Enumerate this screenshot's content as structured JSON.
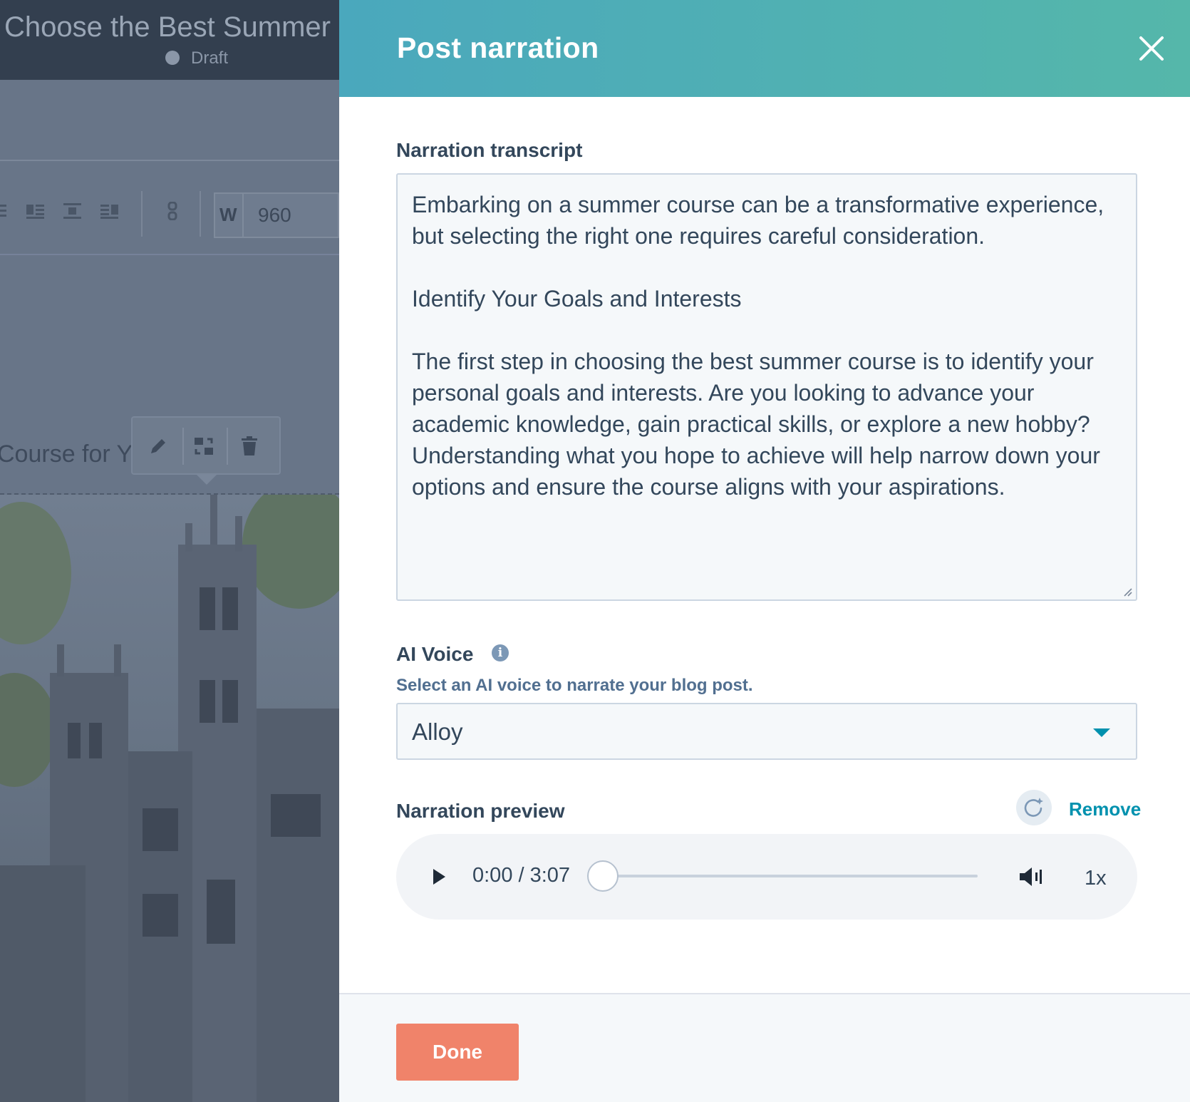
{
  "editor": {
    "doc_title": "Choose the Best Summer Course for You",
    "status": "Draft",
    "width_label": "W",
    "width_value": "960",
    "heading_fragment": "Course for You"
  },
  "panel": {
    "title": "Post narration",
    "transcript_label": "Narration transcript",
    "transcript": "Embarking on a summer course can be a transformative experience, but selecting the right one requires careful consideration.\n\nIdentify Your Goals and Interests\n\nThe first step in choosing the best summer course is to identify your personal goals and interests. Are you looking to advance your academic knowledge, gain practical skills, or explore a new hobby? Understanding what you hope to achieve will help narrow down your options and ensure the course aligns with your aspirations.",
    "voice_label": "AI Voice",
    "voice_help": "Select an AI voice to narrate your blog post.",
    "voice_selected": "Alloy",
    "preview_label": "Narration preview",
    "remove_label": "Remove",
    "player": {
      "time": "0:00 / 3:07",
      "progress": 0,
      "speed": "1x"
    },
    "done_label": "Done"
  },
  "colors": {
    "header_start": "#4aa8bd",
    "header_end": "#55b7aa",
    "accent_link": "#0091ae",
    "primary_button": "#f0836a",
    "text": "#33475b"
  },
  "icons": [
    "close-icon",
    "info-icon",
    "chevron-down-icon",
    "regenerate-icon",
    "play-icon",
    "volume-icon",
    "resize-grip-icon",
    "pencil-icon",
    "swap-icon",
    "trash-icon",
    "link-icon",
    "align-left-icon",
    "align-center-icon",
    "align-right-icon"
  ]
}
